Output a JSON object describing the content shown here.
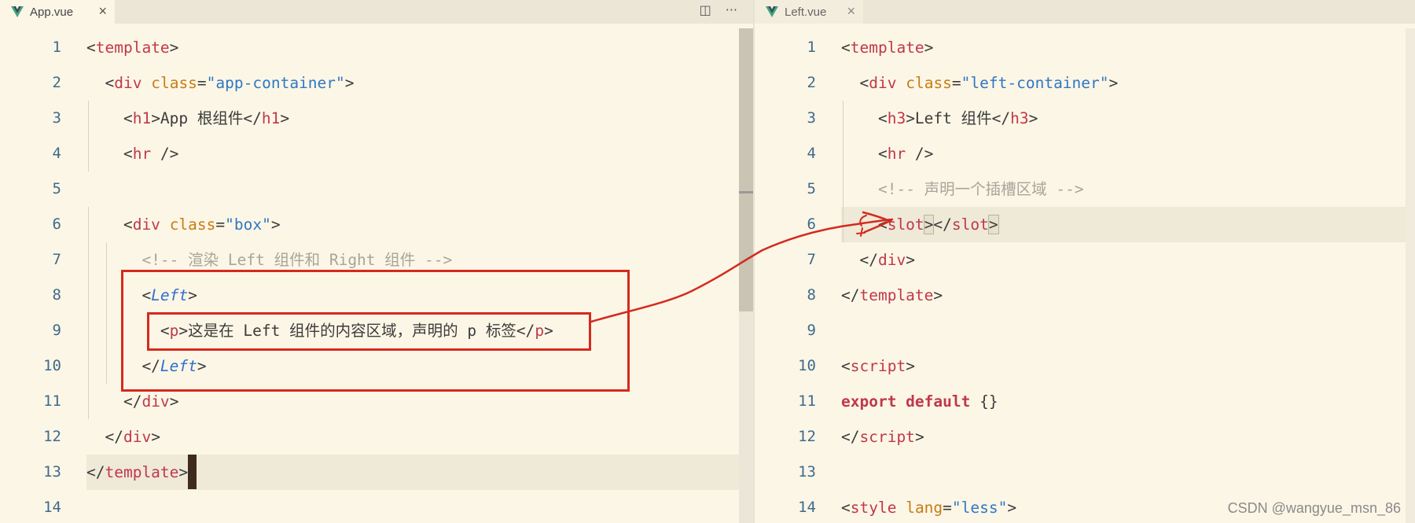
{
  "left_pane": {
    "tab": {
      "label": "App.vue",
      "close": "×"
    },
    "actions": {
      "split": "◫",
      "more": "···"
    },
    "lines": [
      {
        "n": "1",
        "code": [
          {
            "t": "<"
          },
          {
            "t": "template",
            "c": "tag"
          },
          {
            "t": ">"
          }
        ]
      },
      {
        "n": "2",
        "code": [
          {
            "t": "  <"
          },
          {
            "t": "div",
            "c": "tag"
          },
          {
            "t": " "
          },
          {
            "t": "class",
            "c": "attr"
          },
          {
            "t": "="
          },
          {
            "t": "\"app-container\"",
            "c": "str"
          },
          {
            "t": ">"
          }
        ]
      },
      {
        "n": "3",
        "code": [
          {
            "t": "    <"
          },
          {
            "t": "h1",
            "c": "tag"
          },
          {
            "t": ">App 根组件</"
          },
          {
            "t": "h1",
            "c": "tag"
          },
          {
            "t": ">"
          }
        ]
      },
      {
        "n": "4",
        "code": [
          {
            "t": "    <"
          },
          {
            "t": "hr",
            "c": "tag"
          },
          {
            "t": " />"
          }
        ]
      },
      {
        "n": "5",
        "code": []
      },
      {
        "n": "6",
        "code": [
          {
            "t": "    <"
          },
          {
            "t": "div",
            "c": "tag"
          },
          {
            "t": " "
          },
          {
            "t": "class",
            "c": "attr"
          },
          {
            "t": "="
          },
          {
            "t": "\"box\"",
            "c": "str"
          },
          {
            "t": ">"
          }
        ]
      },
      {
        "n": "7",
        "code": [
          {
            "t": "      "
          },
          {
            "t": "<!-- 渲染 Left 组件和 Right 组件 -->",
            "c": "cmt"
          }
        ]
      },
      {
        "n": "8",
        "code": [
          {
            "t": "      <"
          },
          {
            "t": "Left",
            "c": "comp"
          },
          {
            "t": ">"
          }
        ]
      },
      {
        "n": "9",
        "code": [
          {
            "t": "        <"
          },
          {
            "t": "p",
            "c": "tag"
          },
          {
            "t": ">这是在 Left 组件的内容区域，声明的 p 标签</"
          },
          {
            "t": "p",
            "c": "tag"
          },
          {
            "t": ">"
          }
        ]
      },
      {
        "n": "10",
        "code": [
          {
            "t": "      </"
          },
          {
            "t": "Left",
            "c": "comp"
          },
          {
            "t": ">"
          }
        ]
      },
      {
        "n": "11",
        "code": [
          {
            "t": "    </"
          },
          {
            "t": "div",
            "c": "tag"
          },
          {
            "t": ">"
          }
        ]
      },
      {
        "n": "12",
        "code": [
          {
            "t": "  </"
          },
          {
            "t": "div",
            "c": "tag"
          },
          {
            "t": ">"
          }
        ]
      },
      {
        "n": "13",
        "code": [
          {
            "t": "</"
          },
          {
            "t": "template",
            "c": "tag"
          },
          {
            "t": ">"
          }
        ],
        "cursor": true
      },
      {
        "n": "14",
        "code": []
      }
    ]
  },
  "right_pane": {
    "tab": {
      "label": "Left.vue",
      "close": "×"
    },
    "lines": [
      {
        "n": "1",
        "code": [
          {
            "t": "<"
          },
          {
            "t": "template",
            "c": "tag"
          },
          {
            "t": ">"
          }
        ]
      },
      {
        "n": "2",
        "code": [
          {
            "t": "  <"
          },
          {
            "t": "div",
            "c": "tag"
          },
          {
            "t": " "
          },
          {
            "t": "class",
            "c": "attr"
          },
          {
            "t": "="
          },
          {
            "t": "\"left-container\"",
            "c": "str"
          },
          {
            "t": ">"
          }
        ]
      },
      {
        "n": "3",
        "code": [
          {
            "t": "    <"
          },
          {
            "t": "h3",
            "c": "tag"
          },
          {
            "t": ">Left 组件</"
          },
          {
            "t": "h3",
            "c": "tag"
          },
          {
            "t": ">"
          }
        ]
      },
      {
        "n": "4",
        "code": [
          {
            "t": "    <"
          },
          {
            "t": "hr",
            "c": "tag"
          },
          {
            "t": " />"
          }
        ]
      },
      {
        "n": "5",
        "code": [
          {
            "t": "    "
          },
          {
            "t": "<!-- 声明一个插槽区域 -->",
            "c": "cmt"
          }
        ]
      },
      {
        "n": "6",
        "code": [
          {
            "t": "    <"
          },
          {
            "t": "slot",
            "c": "tag"
          },
          {
            "t": ">",
            "c": "bracket-box"
          },
          {
            "t": "</"
          },
          {
            "t": "slot",
            "c": "tag"
          },
          {
            "t": ">",
            "c": "bracket-box"
          }
        ]
      },
      {
        "n": "7",
        "code": [
          {
            "t": "  </"
          },
          {
            "t": "div",
            "c": "tag"
          },
          {
            "t": ">"
          }
        ]
      },
      {
        "n": "8",
        "code": [
          {
            "t": "</"
          },
          {
            "t": "template",
            "c": "tag"
          },
          {
            "t": ">"
          }
        ]
      },
      {
        "n": "9",
        "code": []
      },
      {
        "n": "10",
        "code": [
          {
            "t": "<"
          },
          {
            "t": "script",
            "c": "tag"
          },
          {
            "t": ">"
          }
        ]
      },
      {
        "n": "11",
        "code": [
          {
            "t": "export default",
            "c": "kw"
          },
          {
            "t": " {}"
          }
        ]
      },
      {
        "n": "12",
        "code": [
          {
            "t": "</"
          },
          {
            "t": "script",
            "c": "tag"
          },
          {
            "t": ">"
          }
        ]
      },
      {
        "n": "13",
        "code": []
      },
      {
        "n": "14",
        "code": [
          {
            "t": "<"
          },
          {
            "t": "style",
            "c": "tag"
          },
          {
            "t": " "
          },
          {
            "t": "lang",
            "c": "attr"
          },
          {
            "t": "="
          },
          {
            "t": "\"less\"",
            "c": "str"
          },
          {
            "t": ">"
          }
        ]
      }
    ]
  },
  "watermark": "CSDN @wangyue_msn_86",
  "colors": {
    "background": "#fcf6e6",
    "tag": "#c0384b",
    "attribute": "#c67d14",
    "string": "#2f78c4",
    "comment": "#a6a69a",
    "annotation_red": "#d42a1e",
    "line_number": "#3e6b8c"
  },
  "icons": {
    "file_tab": "vue-logo-icon",
    "split_editor": "split-editor-icon",
    "more": "more-actions-icon"
  }
}
